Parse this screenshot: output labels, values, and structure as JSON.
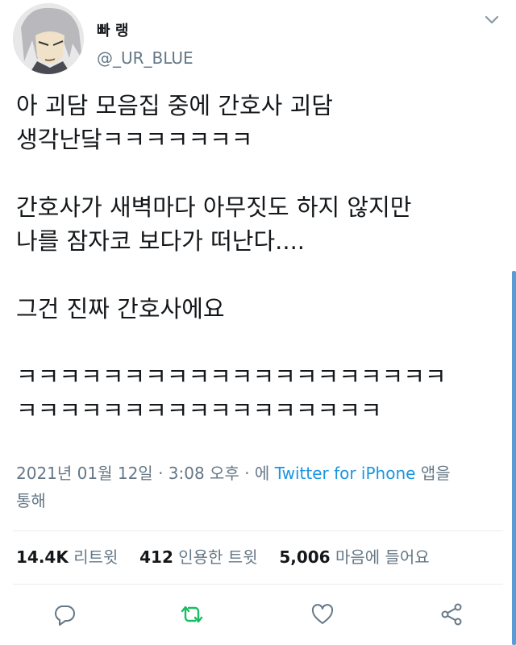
{
  "user": {
    "display_name": "빠 랭",
    "handle": "@_UR_BLUE"
  },
  "tweet": {
    "paragraphs": [
      [
        "아 괴담 모음집 중에 간호사 괴담",
        "생각난닼ㅋㅋㅋㅋㅋㅋㅋ"
      ],
      [
        "간호사가 새벽마다 아무짓도 하지 않지만",
        "나를 잠자코 보다가 떠난다...."
      ],
      [
        "그건 진짜 간호사에요"
      ],
      [
        "ㅋㅋㅋㅋㅋㅋㅋㅋㅋㅋㅋㅋㅋㅋㅋㅋㅋㅋㅋㅋ",
        "ㅋㅋㅋㅋㅋㅋㅋㅋㅋㅋㅋㅋㅋㅋㅋㅋㅋ"
      ]
    ]
  },
  "meta": {
    "datetime": "2021년 01월 12일 · 3:08 오후 · 에",
    "source": "Twitter for iPhone",
    "suffix_line1": "앱을",
    "suffix_line2": "통해"
  },
  "stats": {
    "retweets_count": "14.4K",
    "retweets_label": "리트윗",
    "quotes_count": "412",
    "quotes_label": "인용한 트윗",
    "likes_count": "5,006",
    "likes_label": "마음에 들어요"
  },
  "icons": {
    "reply": "reply-icon",
    "retweet": "retweet-icon",
    "like": "heart-icon",
    "share": "share-icon",
    "menu": "chevron-down-icon"
  },
  "colors": {
    "text": "#14171a",
    "secondary": "#657786",
    "link": "#1b95e0",
    "retweet_green": "#17bf63",
    "divider": "#e6ecf0"
  }
}
